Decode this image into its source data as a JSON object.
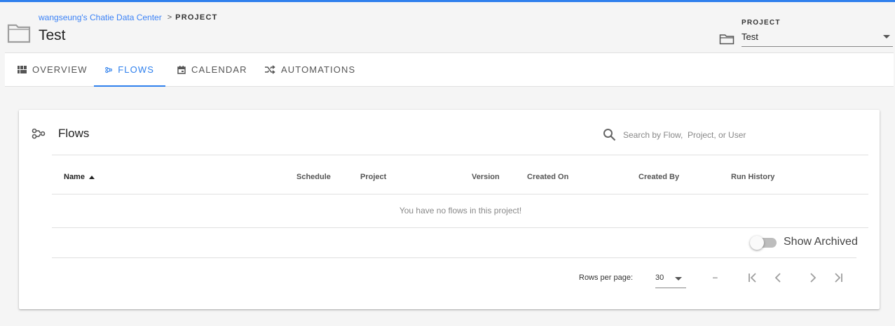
{
  "colors": {
    "accent": "#2f80ed",
    "link": "#3b82f6",
    "background": "#f5f5f5"
  },
  "header": {
    "breadcrumb": {
      "link": "wangseung's Chatie Data Center",
      "current": "PROJECT"
    },
    "title": "Test",
    "project_select": {
      "label": "PROJECT",
      "value": "Test"
    }
  },
  "tabs": [
    {
      "label": "OVERVIEW",
      "icon": "dashboard-icon",
      "active": false
    },
    {
      "label": "FLOWS",
      "icon": "flows-icon",
      "active": true
    },
    {
      "label": "CALENDAR",
      "icon": "calendar-icon",
      "active": false
    },
    {
      "label": "AUTOMATIONS",
      "icon": "shuffle-icon",
      "active": false
    }
  ],
  "flows_card": {
    "title": "Flows",
    "search_placeholder": "Search by Flow,  Project, or User",
    "columns": [
      "Name",
      "Schedule",
      "Project",
      "Version",
      "Created On",
      "Created By",
      "Run History"
    ],
    "sorted_column": "Name",
    "empty_message": "You have no flows in this project!",
    "show_archived": {
      "label": "Show Archived",
      "on": false
    },
    "pagination": {
      "rows_label": "Rows per page:",
      "rows_value": "30",
      "range": "–"
    }
  }
}
